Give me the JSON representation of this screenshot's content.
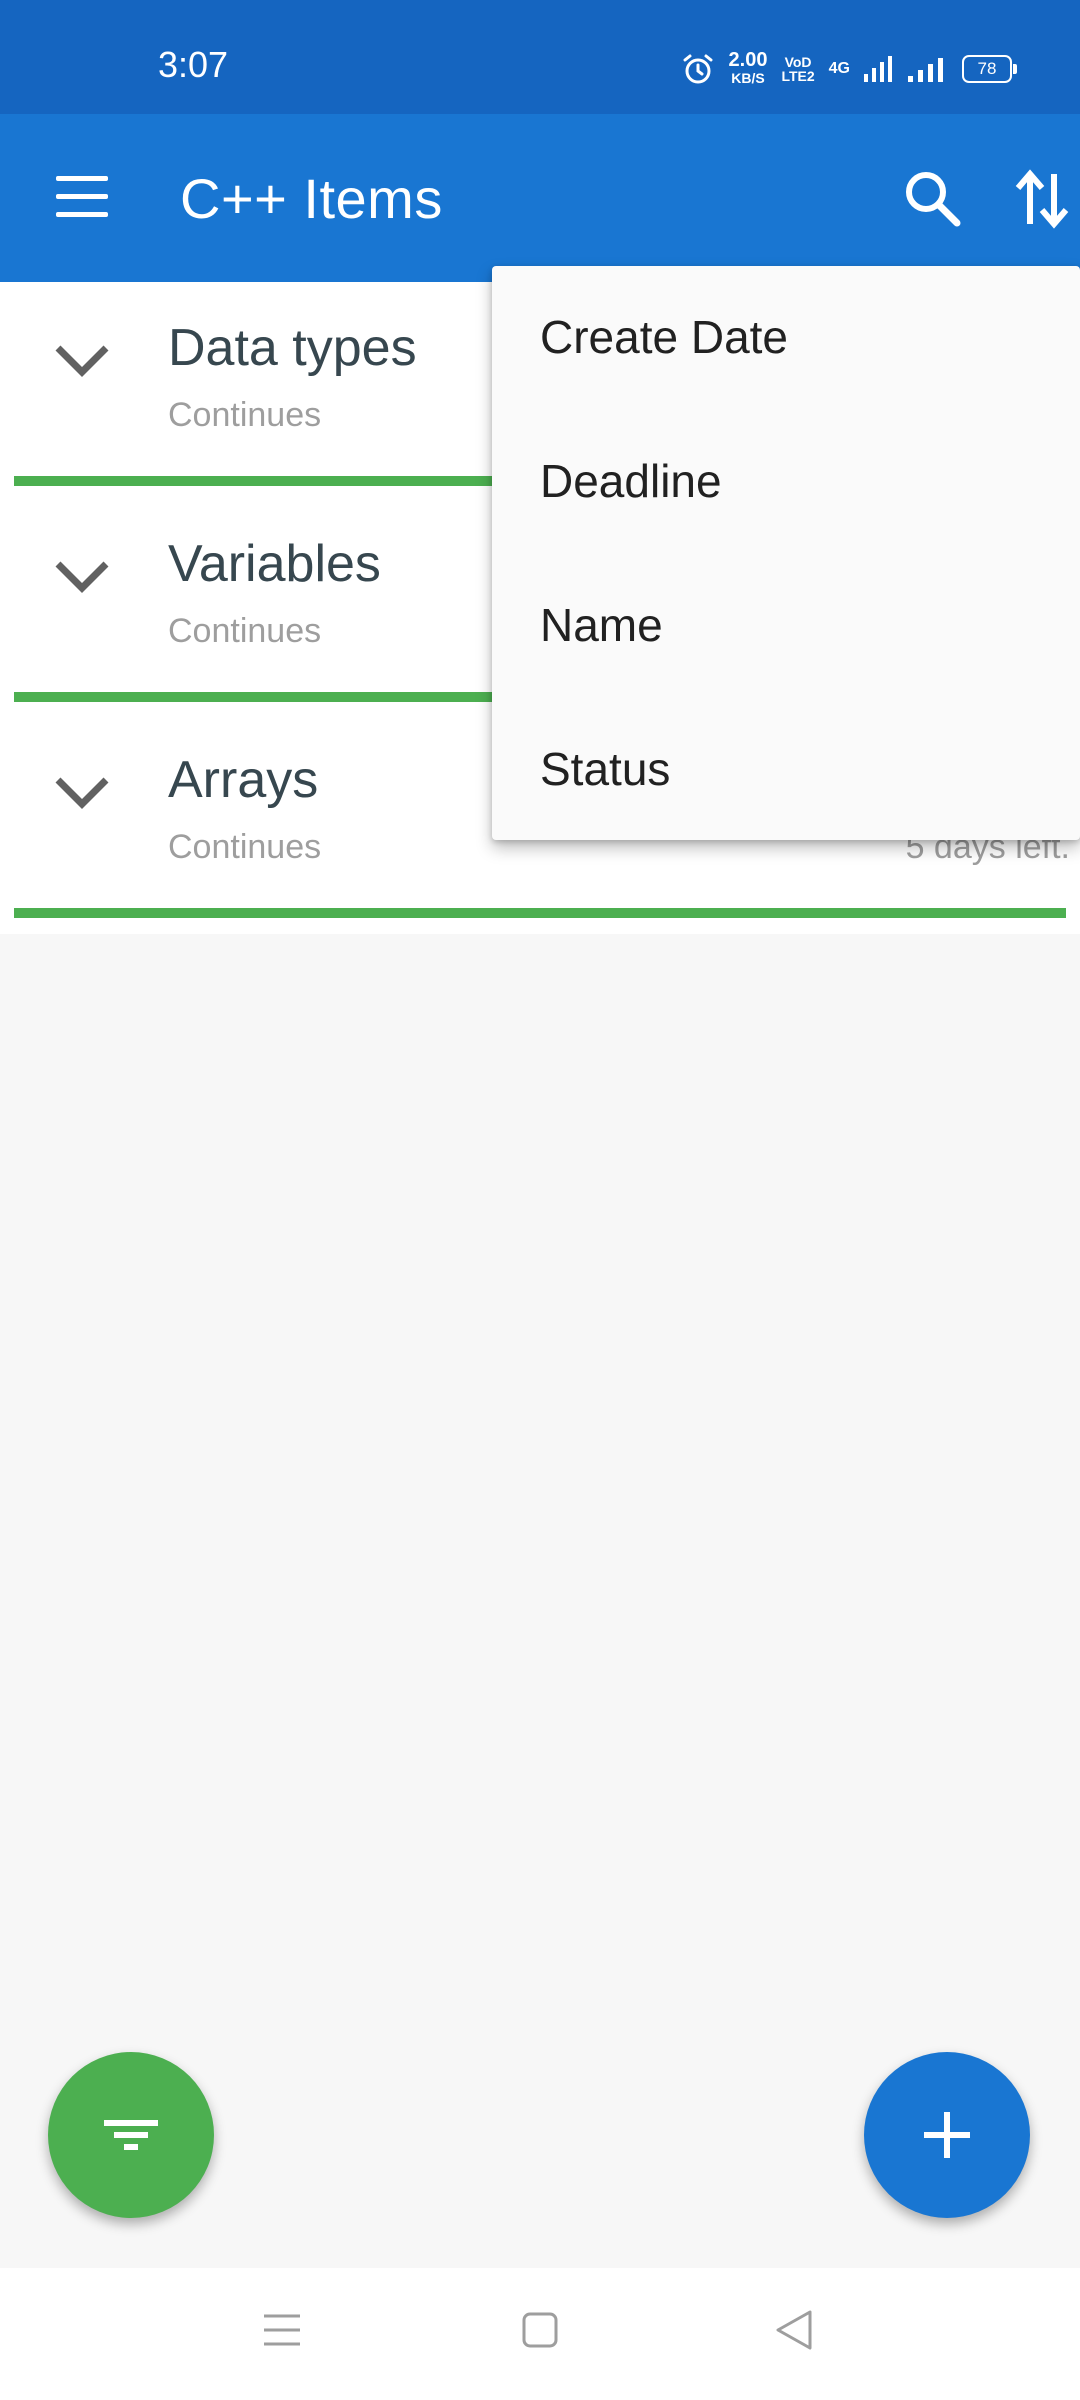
{
  "status_bar": {
    "time": "3:07",
    "net_speed_value": "2.00",
    "net_speed_unit": "KB/S",
    "volte_top": "VoD",
    "volte_bottom": "LTE2",
    "network": "4G",
    "battery": "78"
  },
  "app_bar": {
    "title": "C++ Items"
  },
  "items": [
    {
      "title": "Data types",
      "status": "Continues",
      "deadline": ""
    },
    {
      "title": "Variables",
      "status": "Continues",
      "deadline": ""
    },
    {
      "title": "Arrays",
      "status": "Continues",
      "deadline": "5 days left."
    }
  ],
  "sort_menu": {
    "options": [
      "Create Date",
      "Deadline",
      "Name",
      "Status"
    ]
  },
  "colors": {
    "status_bar": "#1565c0",
    "app_bar": "#1976d2",
    "progress": "#4caf50",
    "fab_filter": "#4caf50",
    "fab_add": "#1976d2"
  }
}
